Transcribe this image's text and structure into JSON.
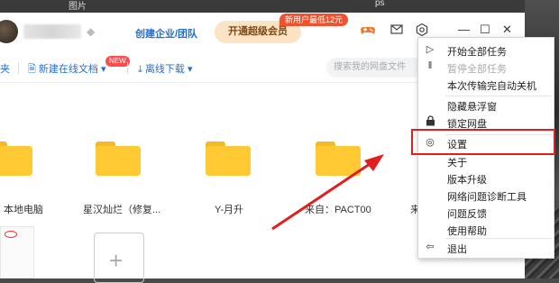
{
  "background": {
    "top_left_text": "图片",
    "top_right_text": "ps"
  },
  "header": {
    "enterprise_label": "创建企业/团队",
    "vip_button_label": "开通超级会员",
    "vip_tag": "新用户最低12元",
    "diamond_icon": "diamond-icon",
    "game_icon": "gamepad-icon",
    "mail_icon": "mail-icon",
    "settings_icon": "gear-icon",
    "window_controls": [
      "—",
      "☐",
      "✕"
    ]
  },
  "toolbar": {
    "folder_partial": "夹",
    "new_online_doc": "新建在线文档",
    "new_badge": "NEW",
    "offline_download": "离线下载",
    "search_placeholder": "搜索我的网盘文件"
  },
  "files": [
    {
      "label": "本地电脑"
    },
    {
      "label": "星汉灿烂（修复..."
    },
    {
      "label": "Y-月升"
    },
    {
      "label": "来自：PACT00"
    },
    {
      "label": "来"
    }
  ],
  "menu": {
    "items": [
      {
        "icon": "▷",
        "icon_name": "play-icon",
        "label": "开始全部任务",
        "disabled": false
      },
      {
        "icon": "‖",
        "icon_name": "pause-icon",
        "label": "暂停全部任务",
        "disabled": true
      },
      {
        "icon": "",
        "icon_name": "",
        "label": "本次传输完自动关机",
        "disabled": false
      },
      {
        "icon": "",
        "icon_name": "",
        "label": "隐藏悬浮窗",
        "disabled": false
      },
      {
        "icon": "🔒",
        "icon_name": "lock-icon",
        "label": "锁定网盘",
        "disabled": false
      },
      {
        "icon": "◎",
        "icon_name": "settings-icon",
        "label": "设置",
        "disabled": false
      },
      {
        "icon": "",
        "icon_name": "",
        "label": "关于",
        "disabled": false
      },
      {
        "icon": "",
        "icon_name": "",
        "label": "版本升级",
        "disabled": false
      },
      {
        "icon": "",
        "icon_name": "",
        "label": "网络问题诊断工具",
        "disabled": false
      },
      {
        "icon": "",
        "icon_name": "",
        "label": "问题反馈",
        "disabled": false
      },
      {
        "icon": "",
        "icon_name": "",
        "label": "使用帮助",
        "disabled": false
      },
      {
        "icon": "⇦",
        "icon_name": "logout-icon",
        "label": "退出",
        "disabled": false
      }
    ]
  },
  "colors": {
    "accent": "#1e6fd9",
    "highlight": "#e02020",
    "folder": "#ffc933"
  }
}
